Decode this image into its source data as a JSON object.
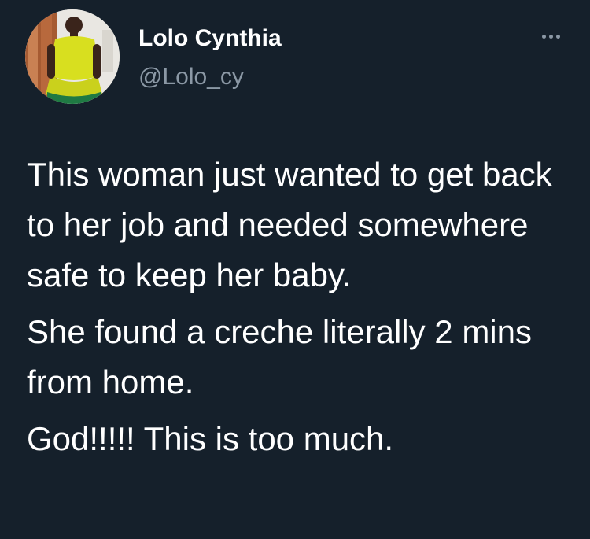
{
  "author": {
    "display_name": "Lolo Cynthia",
    "handle": "@Lolo_cy",
    "avatar_icon": "profile-photo"
  },
  "menu": {
    "icon": "more-horizontal-icon"
  },
  "tweet": {
    "paragraphs": [
      "This woman just wanted to get back to her job and needed somewhere safe to keep her baby.",
      "She found a creche literally 2 mins from home.",
      "God!!!!! This is too much."
    ]
  },
  "colors": {
    "background": "#15202b",
    "text_primary": "#ffffff",
    "text_secondary": "#8b98a5"
  }
}
